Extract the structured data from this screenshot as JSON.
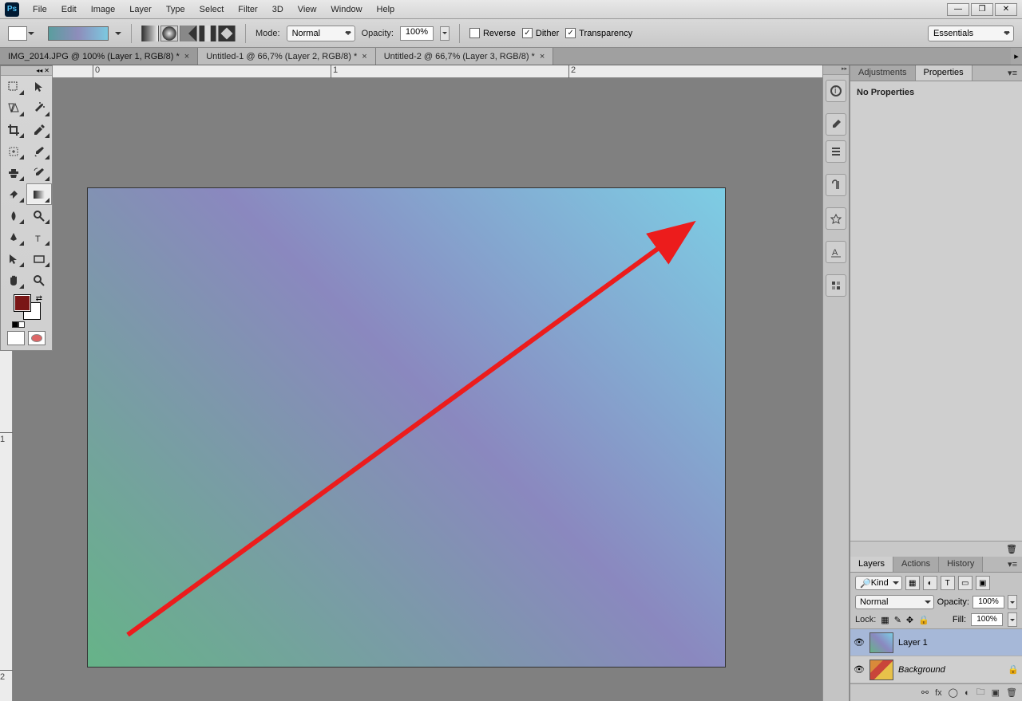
{
  "menu": {
    "items": [
      "File",
      "Edit",
      "Image",
      "Layer",
      "Type",
      "Select",
      "Filter",
      "3D",
      "View",
      "Window",
      "Help"
    ]
  },
  "options": {
    "mode_label": "Mode:",
    "mode_value": "Normal",
    "opacity_label": "Opacity:",
    "opacity_value": "100%",
    "reverse_label": "Reverse",
    "dither_label": "Dither",
    "transparency_label": "Transparency",
    "reverse_checked": false,
    "dither_checked": true,
    "transparency_checked": true,
    "workspace": "Essentials"
  },
  "tabs": [
    {
      "title": "IMG_2014.JPG @ 100% (Layer 1, RGB/8) *",
      "active": true
    },
    {
      "title": "Untitled-1 @ 66,7% (Layer 2, RGB/8) *",
      "active": false
    },
    {
      "title": "Untitled-2 @ 66,7% (Layer 3, RGB/8) *",
      "active": false
    }
  ],
  "ruler_h": [
    "0",
    "1",
    "2"
  ],
  "ruler_v": [
    "1",
    "2"
  ],
  "right_tabs_top": {
    "adjustments": "Adjustments",
    "properties": "Properties",
    "no_props": "No Properties"
  },
  "layers_panel": {
    "tabs": [
      "Layers",
      "Actions",
      "History"
    ],
    "kind": "Kind",
    "blend": "Normal",
    "opacity_label": "Opacity:",
    "opacity_value": "100%",
    "lock_label": "Lock:",
    "fill_label": "Fill:",
    "fill_value": "100%",
    "layers": [
      {
        "name": "Layer 1",
        "locked": false,
        "selected": true,
        "thumb": "grad"
      },
      {
        "name": "Background",
        "locked": true,
        "selected": false,
        "thumb": "bgimg"
      }
    ]
  },
  "colors": {
    "fg": "#7a1616",
    "bg": "#ffffff",
    "arrow": "#ec1c1c"
  }
}
